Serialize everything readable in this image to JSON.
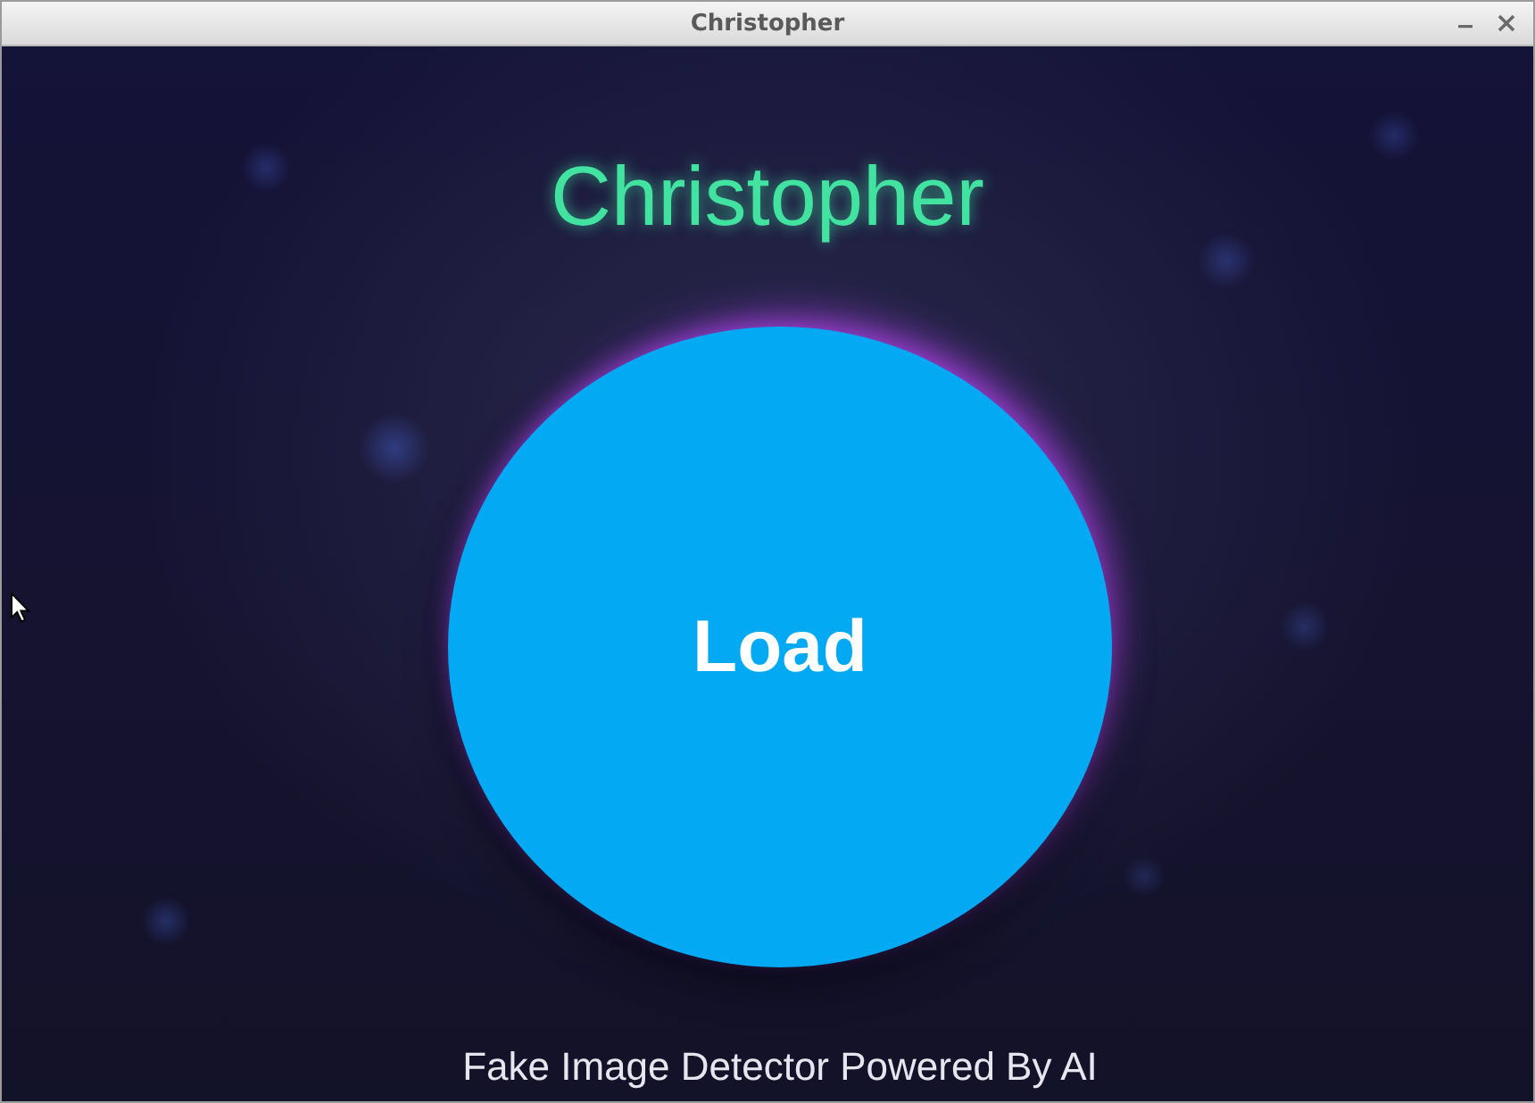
{
  "window": {
    "title": "Christopher"
  },
  "heading": "Christopher",
  "load_button": {
    "label": "Load"
  },
  "footer": "Fake Image Detector Powered By AI"
}
